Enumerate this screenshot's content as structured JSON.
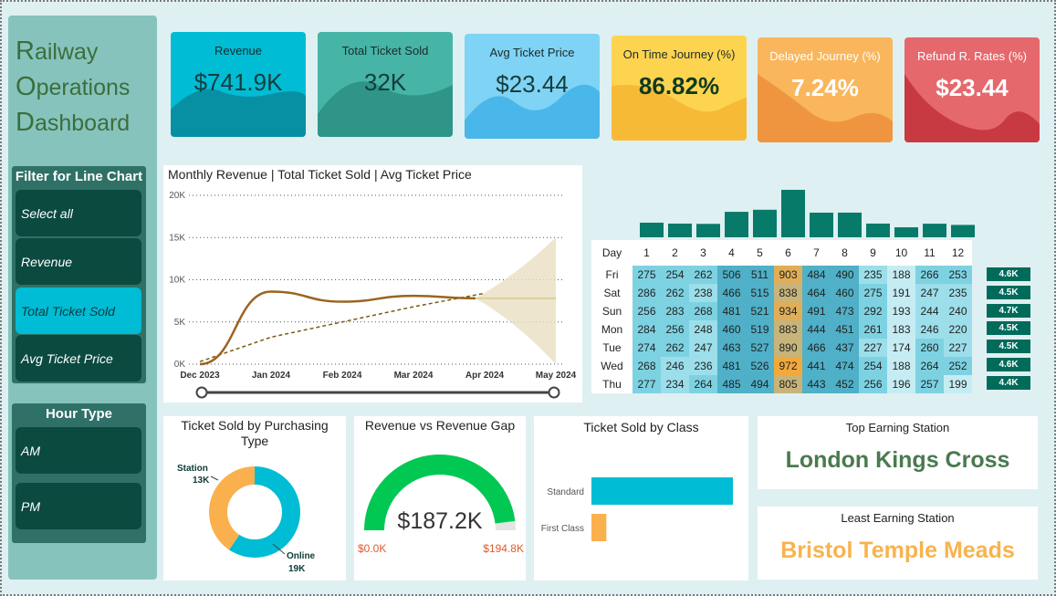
{
  "sidebar": {
    "title_lines": [
      {
        "cap": "R",
        "rest": "ailway"
      },
      {
        "cap": "O",
        "rest": "perations"
      },
      {
        "cap": "D",
        "rest": "ashboard"
      }
    ],
    "filter_title": "Filter for Line Chart",
    "filter_buttons": [
      "Select all",
      "Revenue",
      "Total Ticket Sold",
      "Avg Ticket Price"
    ],
    "filter_active": "Total Ticket Sold",
    "hour_title": "Hour Type",
    "hour_buttons": [
      "AM",
      "PM"
    ]
  },
  "kpis": [
    {
      "label": "Revenue",
      "value": "$741.9K",
      "color": "#00bcd4",
      "wave": "#08889a"
    },
    {
      "label": "Total Ticket Sold",
      "value": "32K",
      "color": "#46b4a6",
      "wave": "#2a8f82"
    },
    {
      "label": "Avg Ticket Price",
      "value": "$23.44",
      "color": "#7fd3f5",
      "wave": "#40b2e6"
    },
    {
      "label": "On Time Journey (%)",
      "value": "86.82%",
      "color": "#fdd450",
      "wave": "#f6b533"
    },
    {
      "label": "Delayed Journey (%)",
      "value": "7.24%",
      "color": "#f9b65c",
      "wave": "#ee8f3a"
    },
    {
      "label": "Refund R. Rates (%)",
      "value": "$23.44",
      "color": "#e5686d",
      "wave": "#c3323a"
    }
  ],
  "line_chart": {
    "title": "Monthly Revenue | Total Ticket Sold | Avg Ticket Price",
    "chart_data": {
      "type": "line",
      "x": [
        "Dec 2023",
        "Jan 2024",
        "Feb 2024",
        "Mar 2024",
        "Apr 2024",
        "May 2024"
      ],
      "series": [
        {
          "values": [
            0,
            8600,
            7400,
            8100,
            7800,
            null
          ]
        }
      ],
      "trend": [
        300,
        3200,
        5000,
        6800,
        8400
      ],
      "forecast_value": 7800,
      "forecast_band": {
        "upper": 15000,
        "lower": 0
      },
      "ylim": [
        0,
        20000
      ],
      "yticks": [
        "0K",
        "5K",
        "10K",
        "15K",
        "20K"
      ],
      "line_color": "#9a6420"
    }
  },
  "heatmap": {
    "chart_data": {
      "type": "heatmap",
      "header": "Day",
      "columns": [
        "1",
        "2",
        "3",
        "4",
        "5",
        "6",
        "7",
        "8",
        "9",
        "10",
        "11",
        "12"
      ],
      "rows": [
        {
          "day": "Fri",
          "values": [
            275,
            254,
            262,
            506,
            511,
            903,
            484,
            490,
            235,
            188,
            266,
            253
          ],
          "total": "4.6K"
        },
        {
          "day": "Sat",
          "values": [
            286,
            262,
            238,
            466,
            515,
            838,
            464,
            460,
            275,
            191,
            247,
            235
          ],
          "total": "4.5K"
        },
        {
          "day": "Sun",
          "values": [
            256,
            283,
            268,
            481,
            521,
            934,
            491,
            473,
            292,
            193,
            244,
            240
          ],
          "total": "4.7K"
        },
        {
          "day": "Mon",
          "values": [
            284,
            256,
            248,
            460,
            519,
            883,
            444,
            451,
            261,
            183,
            246,
            220
          ],
          "total": "4.5K"
        },
        {
          "day": "Tue",
          "values": [
            274,
            262,
            247,
            463,
            527,
            890,
            466,
            437,
            227,
            174,
            260,
            227
          ],
          "total": "4.5K"
        },
        {
          "day": "Wed",
          "values": [
            268,
            246,
            236,
            481,
            526,
            972,
            441,
            474,
            254,
            188,
            264,
            252
          ],
          "total": "4.6K"
        },
        {
          "day": "Thu",
          "values": [
            277,
            234,
            264,
            485,
            494,
            805,
            443,
            452,
            256,
            196,
            257,
            199
          ],
          "total": "4.4K"
        }
      ],
      "column_totals": [
        1920,
        1797,
        1763,
        3342,
        3613,
        6225,
        3233,
        3237,
        1800,
        1313,
        1784,
        1626
      ]
    }
  },
  "donut": {
    "title": "Ticket Sold by Purchasing Type",
    "chart_data": {
      "type": "pie",
      "slices": [
        {
          "label": "Online",
          "value": 19,
          "display": "19K",
          "color": "#00bcd4"
        },
        {
          "label": "Station",
          "value": 13,
          "display": "13K",
          "color": "#fbb04e"
        }
      ]
    }
  },
  "gauge": {
    "title": "Revenue vs Revenue Gap",
    "value_label": "$187.2K",
    "min_label": "$0.0K",
    "max_label": "$194.8K",
    "value": 187.2,
    "max": 194.8,
    "color": "#00c853"
  },
  "class_chart": {
    "title": "Ticket Sold by Class",
    "chart_data": {
      "type": "bar",
      "categories": [
        "Standard",
        "First Class"
      ],
      "values": [
        28.5,
        3.0
      ],
      "colors": [
        "#00bcd4",
        "#fbb04e"
      ]
    }
  },
  "stations": {
    "top_title": "Top Earning Station",
    "top_value": "London Kings Cross",
    "top_color": "#4a7a4f",
    "least_title": "Least Earning Station",
    "least_value": "Bristol Temple Meads",
    "least_color": "#f8b34d"
  }
}
